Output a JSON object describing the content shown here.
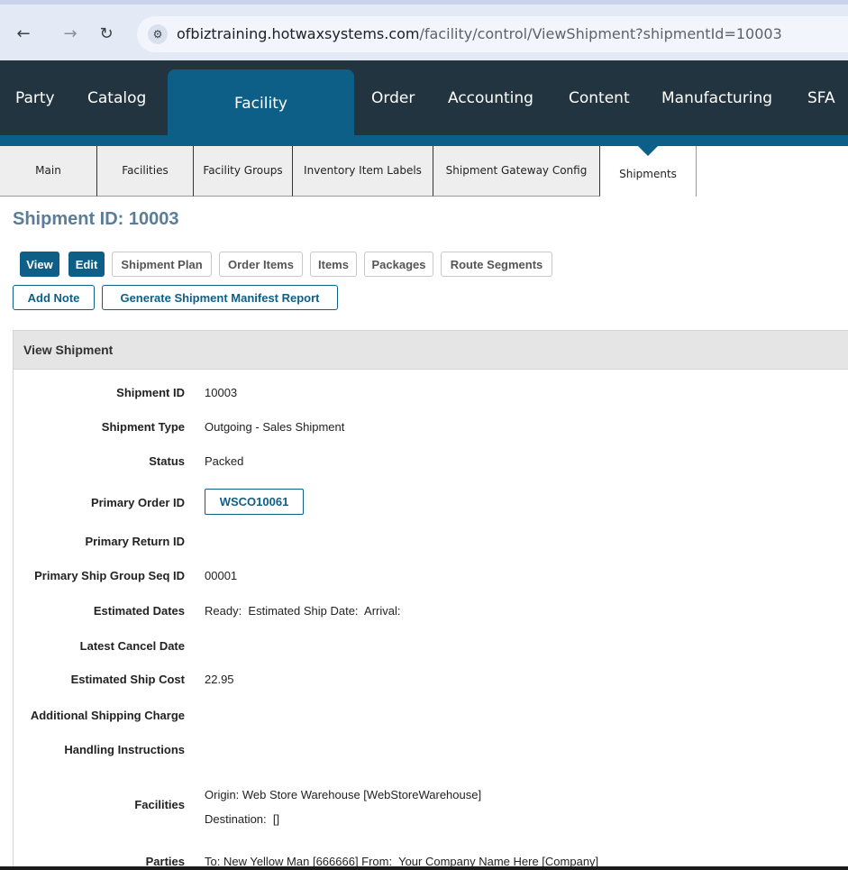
{
  "browser": {
    "url_host": "ofbiztraining.hotwaxsystems.com",
    "url_path": "/facility/control/ViewShipment?shipmentId=10003"
  },
  "main_nav": [
    "Party",
    "Catalog",
    "Facility",
    "Order",
    "Accounting",
    "Content",
    "Manufacturing",
    "SFA"
  ],
  "sub_nav": [
    "Main",
    "Facilities",
    "Facility Groups",
    "Inventory Item Labels",
    "Shipment Gateway Config",
    "Shipments"
  ],
  "page": {
    "title": "Shipment ID: 10003"
  },
  "actions": {
    "view": "View",
    "edit": "Edit",
    "shipment_plan": "Shipment Plan",
    "order_items": "Order Items",
    "items": "Items",
    "packages": "Packages",
    "route_segments": "Route Segments",
    "add_note": "Add Note",
    "generate_manifest": "Generate Shipment Manifest Report"
  },
  "panel": {
    "title": "View Shipment",
    "fields": {
      "shipment_id": {
        "label": "Shipment ID",
        "value": "10003"
      },
      "shipment_type": {
        "label": "Shipment Type",
        "value": "Outgoing - Sales Shipment"
      },
      "status": {
        "label": "Status",
        "value": "Packed"
      },
      "primary_order_id": {
        "label": "Primary Order ID",
        "value": "WSCO10061"
      },
      "primary_return_id": {
        "label": "Primary Return ID",
        "value": ""
      },
      "primary_ship_group_seq_id": {
        "label": "Primary Ship Group Seq ID",
        "value": "00001"
      },
      "estimated_dates": {
        "label": "Estimated Dates",
        "value": "Ready:  Estimated Ship Date:  Arrival:"
      },
      "latest_cancel_date": {
        "label": "Latest Cancel Date",
        "value": ""
      },
      "estimated_ship_cost": {
        "label": "Estimated Ship Cost",
        "value": "22.95"
      },
      "additional_shipping_charge": {
        "label": "Additional Shipping Charge",
        "value": ""
      },
      "handling_instructions": {
        "label": "Handling Instructions",
        "value": ""
      },
      "facilities": {
        "label": "Facilities",
        "origin": "Origin: Web Store Warehouse [WebStoreWarehouse]",
        "destination": "Destination:  []"
      },
      "parties": {
        "label": "Parties",
        "value": "To: New Yellow Man [666666] From:  Your Company Name Here [Company]"
      }
    }
  }
}
